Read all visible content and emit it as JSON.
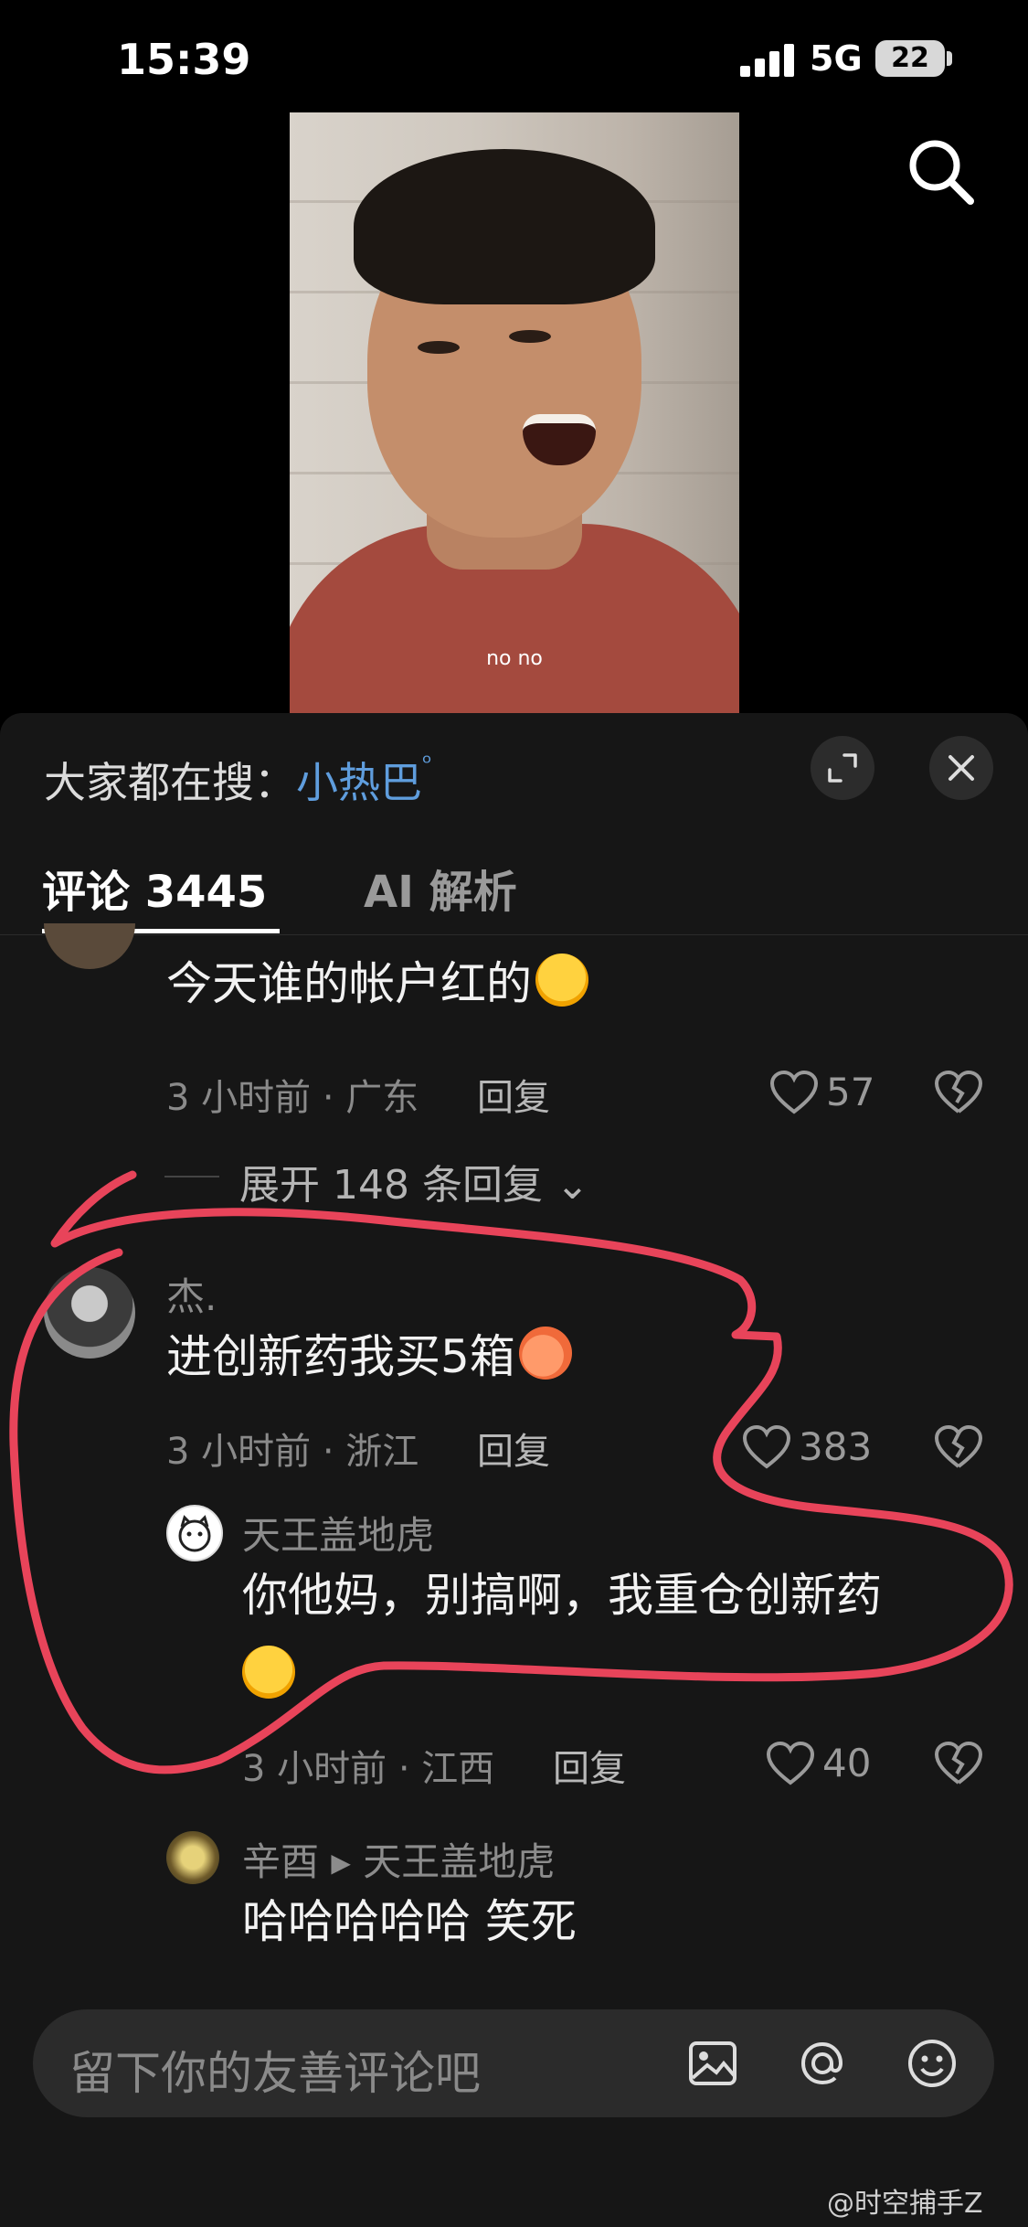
{
  "status_bar": {
    "time": "15:39",
    "network": "5G",
    "battery": "22"
  },
  "video": {
    "caption": "no no"
  },
  "comment_panel": {
    "trending_prefix": "大家都在搜：",
    "trending_keyword": "小热巴",
    "tabs": [
      {
        "label": "评论 3445",
        "active": true
      },
      {
        "label": "AI 解析",
        "active": false
      }
    ],
    "comments": [
      {
        "username": "",
        "content": "今天谁的帐户红的",
        "emoji": "rofl-emoji",
        "time_location": "3 小时前 · 广东",
        "reply_label": "回复",
        "likes": "57",
        "expand_replies": "展开 148 条回复"
      },
      {
        "username": "杰.",
        "content": "进创新药我买5箱",
        "emoji": "peach-emoji",
        "time_location": "3 小时前 · 浙江",
        "reply_label": "回复",
        "likes": "383"
      },
      {
        "username": "天王盖地虎",
        "content_line1": "你他妈，别搞啊，我重仓创新药",
        "emoji": "crying-emoji",
        "time_location": "3 小时前 · 江西",
        "reply_label": "回复",
        "likes": "40"
      },
      {
        "username": "辛酉",
        "reply_to": "天王盖地虎",
        "content": "哈哈哈哈哈 笑死"
      }
    ]
  },
  "input": {
    "placeholder": "留下你的友善评论吧"
  },
  "watermark": "@时空捕手Z",
  "colors": {
    "accent_blue": "#5f9ddd",
    "annotation_red": "#e8445a",
    "panel_bg": "#161616"
  }
}
